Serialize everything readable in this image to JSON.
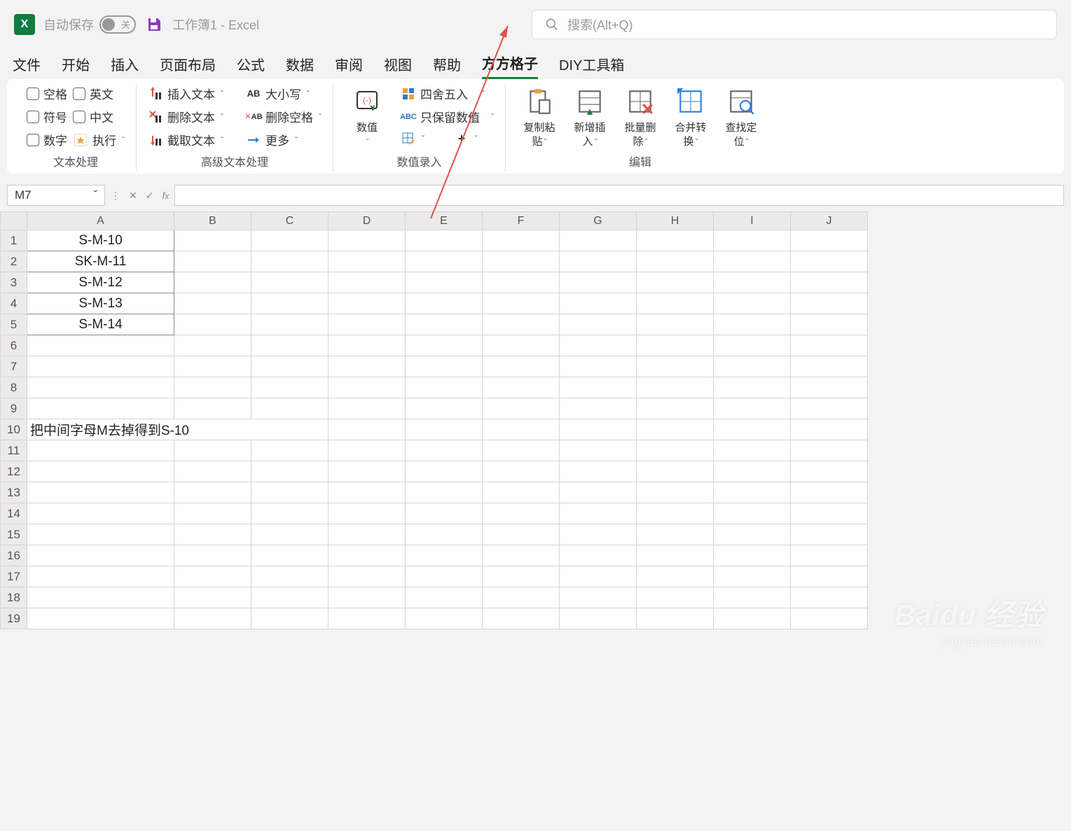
{
  "title": {
    "autosave_label": "自动保存",
    "autosave_state": "关",
    "doc_name": "工作簿1",
    "app_suffix": "  -  Excel",
    "search_placeholder": "搜索(Alt+Q)"
  },
  "tabs": [
    "文件",
    "开始",
    "插入",
    "页面布局",
    "公式",
    "数据",
    "审阅",
    "视图",
    "帮助",
    "方方格子",
    "DIY工具箱"
  ],
  "active_tab": "方方格子",
  "ribbon": {
    "group1": {
      "label": "文本处理",
      "checks_left": [
        "空格",
        "符号",
        "数字"
      ],
      "checks_right": [
        "英文",
        "中文"
      ],
      "exec": "执行"
    },
    "group2": {
      "label": "高级文本处理",
      "col1": [
        "插入文本",
        "删除文本",
        "截取文本"
      ],
      "col2": [
        "大小写",
        "删除空格",
        "更多"
      ]
    },
    "group3": {
      "label": "数值录入",
      "numeric": "数值",
      "right": [
        "四舍五入",
        "只保留数值"
      ]
    },
    "group4": {
      "label": "编辑",
      "btns": [
        {
          "l1": "复制粘",
          "l2": "贴"
        },
        {
          "l1": "新增插",
          "l2": "入"
        },
        {
          "l1": "批量删",
          "l2": "除"
        },
        {
          "l1": "合并转",
          "l2": "换"
        },
        {
          "l1": "查找定",
          "l2": "位"
        }
      ]
    }
  },
  "namebox": "M7",
  "columns": [
    "A",
    "B",
    "C",
    "D",
    "E",
    "F",
    "G",
    "H",
    "I",
    "J"
  ],
  "rows": [
    1,
    2,
    3,
    4,
    5,
    6,
    7,
    8,
    9,
    10,
    11,
    12,
    13,
    14,
    15,
    16,
    17,
    18,
    19
  ],
  "cells": {
    "A1": "S-M-10",
    "A2": "SK-M-11",
    "A3": "S-M-12",
    "A4": "S-M-13",
    "A5": "S-M-14",
    "A10": "把中间字母M去掉得到S-10"
  },
  "watermark": {
    "line1": "Baidu 经验",
    "line2": "jingyan.baidu.com"
  }
}
